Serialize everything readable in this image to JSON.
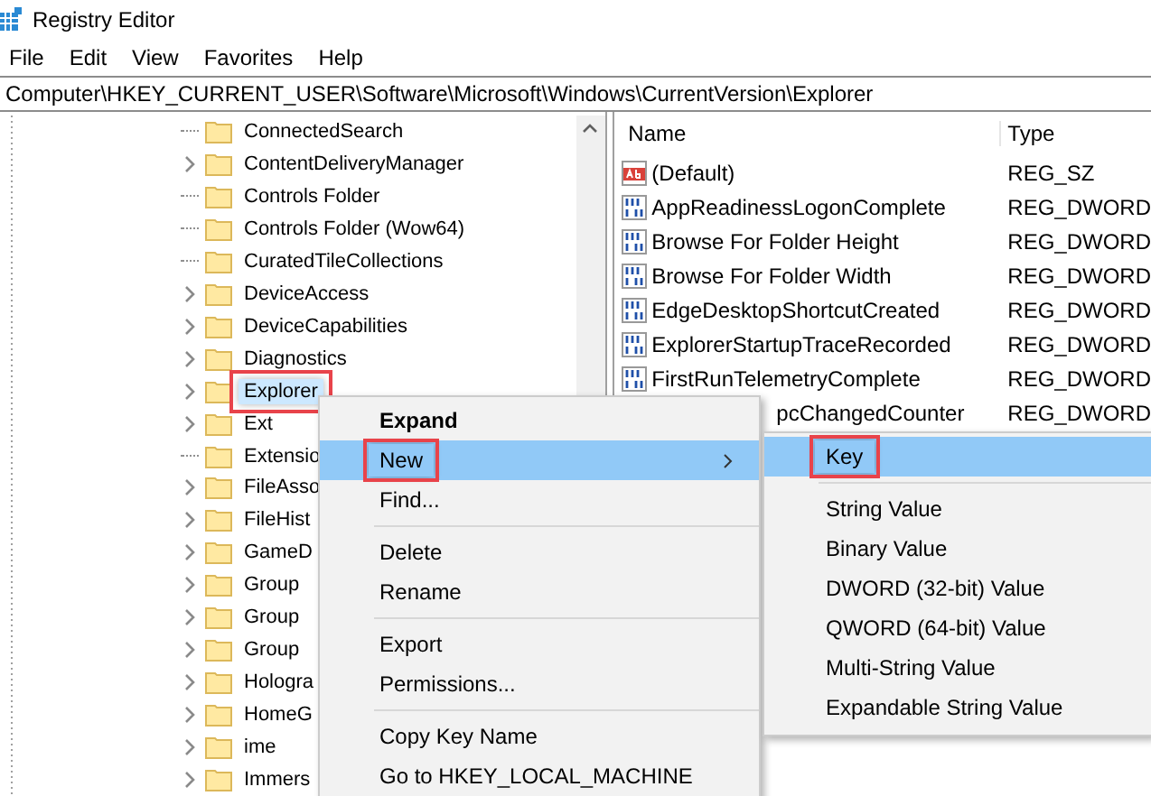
{
  "window": {
    "title": "Registry Editor"
  },
  "menu_bar": [
    "File",
    "Edit",
    "View",
    "Favorites",
    "Help"
  ],
  "address": "Computer\\HKEY_CURRENT_USER\\Software\\Microsoft\\Windows\\CurrentVersion\\Explorer",
  "tree": {
    "items": [
      {
        "label": "ConnectedSearch",
        "expandable": false,
        "selected": false,
        "annotated": false
      },
      {
        "label": "ContentDeliveryManager",
        "expandable": true,
        "selected": false,
        "annotated": false
      },
      {
        "label": "Controls Folder",
        "expandable": false,
        "selected": false,
        "annotated": false
      },
      {
        "label": "Controls Folder (Wow64)",
        "expandable": false,
        "selected": false,
        "annotated": false
      },
      {
        "label": "CuratedTileCollections",
        "expandable": false,
        "selected": false,
        "annotated": false
      },
      {
        "label": "DeviceAccess",
        "expandable": true,
        "selected": false,
        "annotated": false
      },
      {
        "label": "DeviceCapabilities",
        "expandable": true,
        "selected": false,
        "annotated": false
      },
      {
        "label": "Diagnostics",
        "expandable": true,
        "selected": false,
        "annotated": false
      },
      {
        "label": "Explorer",
        "expandable": true,
        "selected": true,
        "annotated": true
      },
      {
        "label": "Ext",
        "expandable": true,
        "selected": false,
        "annotated": false
      },
      {
        "label": "Extensio",
        "expandable": false,
        "selected": false,
        "annotated": false
      },
      {
        "label": "FileAsso",
        "expandable": true,
        "selected": false,
        "annotated": false
      },
      {
        "label": "FileHist",
        "expandable": true,
        "selected": false,
        "annotated": false
      },
      {
        "label": "GameD",
        "expandable": true,
        "selected": false,
        "annotated": false
      },
      {
        "label": "Group",
        "expandable": true,
        "selected": false,
        "annotated": false
      },
      {
        "label": "Group",
        "expandable": true,
        "selected": false,
        "annotated": false
      },
      {
        "label": "Group",
        "expandable": true,
        "selected": false,
        "annotated": false
      },
      {
        "label": "Hologra",
        "expandable": true,
        "selected": false,
        "annotated": false
      },
      {
        "label": "HomeG",
        "expandable": true,
        "selected": false,
        "annotated": false
      },
      {
        "label": "ime",
        "expandable": true,
        "selected": false,
        "annotated": false
      },
      {
        "label": "Immers",
        "expandable": true,
        "selected": false,
        "annotated": false
      }
    ]
  },
  "values": {
    "columns": [
      "Name",
      "Type"
    ],
    "rows": [
      {
        "name": "(Default)",
        "type": "REG_SZ",
        "kind": "string"
      },
      {
        "name": "AppReadinessLogonComplete",
        "type": "REG_DWORD",
        "kind": "binary"
      },
      {
        "name": "Browse For Folder Height",
        "type": "REG_DWORD",
        "kind": "binary"
      },
      {
        "name": "Browse For Folder Width",
        "type": "REG_DWORD",
        "kind": "binary"
      },
      {
        "name": "EdgeDesktopShortcutCreated",
        "type": "REG_DWORD",
        "kind": "binary"
      },
      {
        "name": "ExplorerStartupTraceRecorded",
        "type": "REG_DWORD",
        "kind": "binary"
      },
      {
        "name": "FirstRunTelemetryComplete",
        "type": "REG_DWORD",
        "kind": "binary"
      },
      {
        "name": "pcChangedCounter",
        "type": "REG_DWORD",
        "kind": "covered"
      }
    ]
  },
  "context_menu": {
    "items": [
      {
        "kind": "item",
        "label": "Expand",
        "bold": true,
        "selected": false,
        "annotated": false,
        "submenu": false
      },
      {
        "kind": "item",
        "label": "New",
        "bold": false,
        "selected": true,
        "annotated": true,
        "submenu": true
      },
      {
        "kind": "item",
        "label": "Find...",
        "bold": false,
        "selected": false,
        "annotated": false,
        "submenu": false
      },
      {
        "kind": "separator"
      },
      {
        "kind": "item",
        "label": "Delete",
        "bold": false,
        "selected": false,
        "annotated": false,
        "submenu": false
      },
      {
        "kind": "item",
        "label": "Rename",
        "bold": false,
        "selected": false,
        "annotated": false,
        "submenu": false
      },
      {
        "kind": "separator"
      },
      {
        "kind": "item",
        "label": "Export",
        "bold": false,
        "selected": false,
        "annotated": false,
        "submenu": false
      },
      {
        "kind": "item",
        "label": "Permissions...",
        "bold": false,
        "selected": false,
        "annotated": false,
        "submenu": false
      },
      {
        "kind": "separator"
      },
      {
        "kind": "item",
        "label": "Copy Key Name",
        "bold": false,
        "selected": false,
        "annotated": false,
        "submenu": false
      },
      {
        "kind": "item",
        "label": "Go to HKEY_LOCAL_MACHINE",
        "bold": false,
        "selected": false,
        "annotated": false,
        "submenu": false
      }
    ]
  },
  "submenu": {
    "items": [
      {
        "kind": "item",
        "label": "Key",
        "selected": true,
        "annotated": true
      },
      {
        "kind": "separator"
      },
      {
        "kind": "item",
        "label": "String Value",
        "selected": false,
        "annotated": false
      },
      {
        "kind": "item",
        "label": "Binary Value",
        "selected": false,
        "annotated": false
      },
      {
        "kind": "item",
        "label": "DWORD (32-bit) Value",
        "selected": false,
        "annotated": false
      },
      {
        "kind": "item",
        "label": "QWORD (64-bit) Value",
        "selected": false,
        "annotated": false
      },
      {
        "kind": "item",
        "label": "Multi-String Value",
        "selected": false,
        "annotated": false
      },
      {
        "kind": "item",
        "label": "Expandable String Value",
        "selected": false,
        "annotated": false
      }
    ]
  }
}
